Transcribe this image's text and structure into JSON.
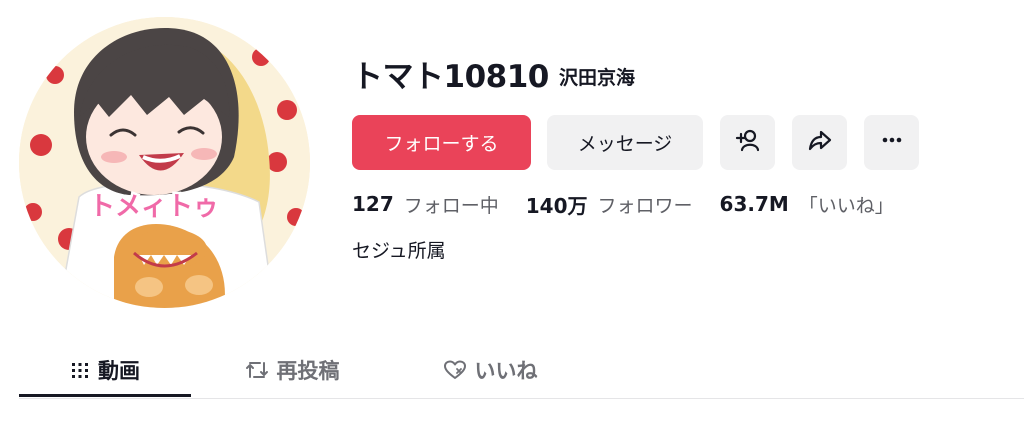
{
  "profile": {
    "username": "トマト10810",
    "nickname": "沢田京海",
    "bio": "セジュ所属",
    "avatar_text": "トメィトゥ"
  },
  "actions": {
    "follow_label": "フォローする",
    "message_label": "メッセージ",
    "add_friend_icon": "add-user-icon",
    "share_icon": "share-icon",
    "more_icon": "more-icon"
  },
  "stats": {
    "following_count": "127",
    "following_label": "フォロー中",
    "followers_count": "140万",
    "followers_label": "フォロワー",
    "likes_count": "63.7M",
    "likes_label": "「いいね」"
  },
  "tabs": [
    {
      "label": "動画",
      "icon": "grid-icon",
      "active": true
    },
    {
      "label": "再投稿",
      "icon": "repost-icon",
      "active": false
    },
    {
      "label": "いいね",
      "icon": "liked-heart-icon",
      "active": false
    }
  ],
  "colors": {
    "accent": "#ea4359",
    "text": "#161823",
    "muted": "#6f7076",
    "button_bg": "#f1f1f2"
  }
}
